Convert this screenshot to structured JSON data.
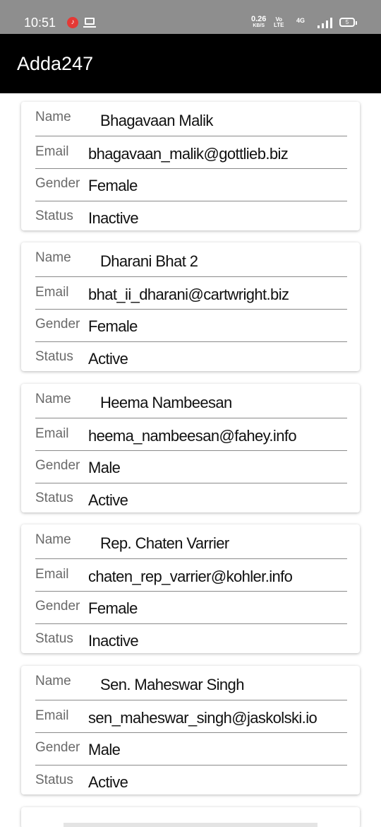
{
  "status_bar": {
    "time": "10:51",
    "net_speed": "0.26",
    "net_speed_unit": "KB/S",
    "volte": "Vo",
    "volte_sub": "LTE",
    "network": "4G",
    "battery": "5",
    "icons": [
      "music-notification-icon",
      "laptop-icon",
      "signal-icon",
      "battery-icon"
    ]
  },
  "app_bar": {
    "title": "Adda247",
    "background": "#000000"
  },
  "labels": {
    "name": "Name",
    "email": "Email",
    "gender": "Gender",
    "status": "Status"
  },
  "users": [
    {
      "name": "Bhagavaan Malik",
      "email": "bhagavaan_malik@gottlieb.biz",
      "gender": "Female",
      "status": "Inactive"
    },
    {
      "name": "Dharani Bhat 2",
      "email": "bhat_ii_dharani@cartwright.biz",
      "gender": "Female",
      "status": "Active"
    },
    {
      "name": "Heema Nambeesan",
      "email": "heema_nambeesan@fahey.info",
      "gender": "Male",
      "status": "Active"
    },
    {
      "name": "Rep. Chaten Varrier",
      "email": "chaten_rep_varrier@kohler.info",
      "gender": "Female",
      "status": "Inactive"
    },
    {
      "name": "Sen. Maheswar Singh",
      "email": "sen_maheswar_singh@jaskolski.io",
      "gender": "Male",
      "status": "Active"
    }
  ],
  "colors": {
    "status_bar": "#8e8e8e",
    "label": "#6a6a6a",
    "value": "#111111",
    "divider": "#8a8a8a"
  }
}
